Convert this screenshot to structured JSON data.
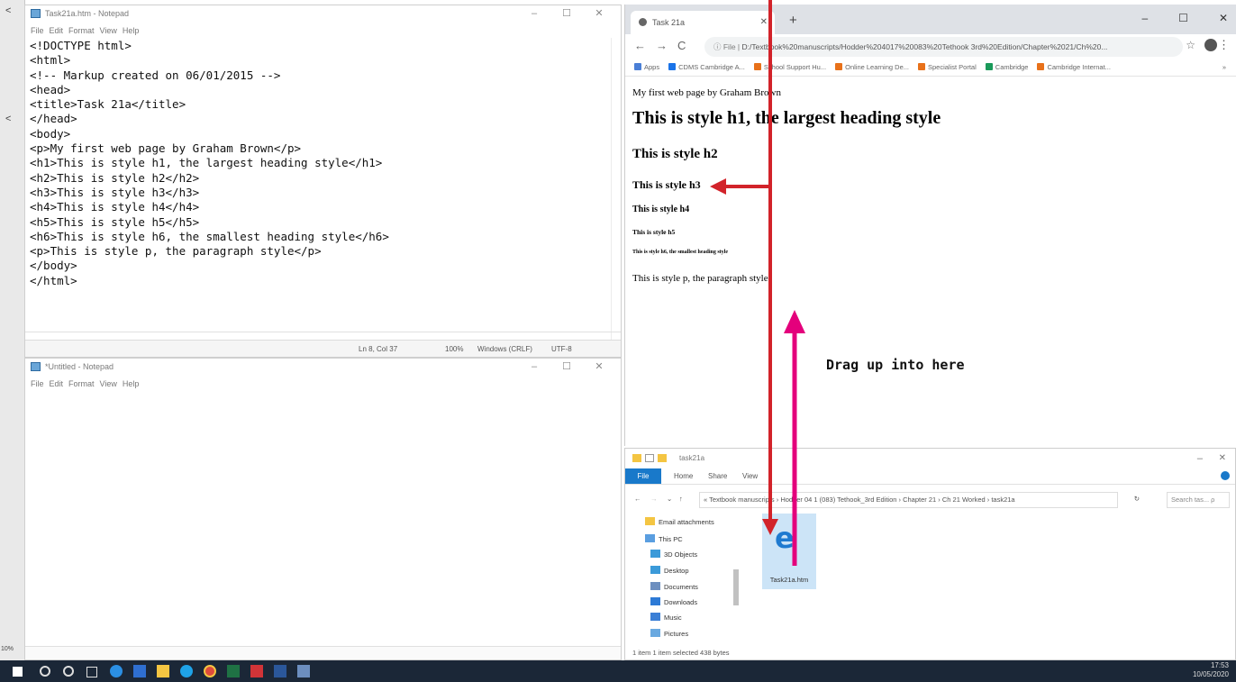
{
  "left_strip": {
    "glyphs": [
      "<",
      "<"
    ],
    "zoom_fragment": "10%"
  },
  "notepad1": {
    "title": "Task21a.htm - Notepad",
    "menu": [
      "File",
      "Edit",
      "Format",
      "View",
      "Help"
    ],
    "controls": [
      "–",
      "☐",
      "✕"
    ],
    "code": "<!DOCTYPE html>\n<html>\n<!-- Markup created on 06/01/2015 -->\n<head>\n<title>Task 21a</title>\n</head>\n<body>\n<p>My first web page by Graham Brown</p>\n<h1>This is style h1, the largest heading style</h1>\n<h2>This is style h2</h2>\n<h3>This is style h3</h3>\n<h4>This is style h4</h4>\n<h5>This is style h5</h5>\n<h6>This is style h6, the smallest heading style</h6>\n<p>This is style p, the paragraph style</p>\n</body>\n</html>",
    "status": {
      "position": "Ln 8, Col 37",
      "zoom": "100%",
      "line_endings": "Windows (CRLF)",
      "encoding": "UTF-8"
    }
  },
  "notepad2": {
    "title": "*Untitled - Notepad",
    "menu": [
      "File",
      "Edit",
      "Format",
      "View",
      "Help"
    ],
    "controls": [
      "–",
      "☐",
      "✕"
    ]
  },
  "chrome": {
    "tab_title": "Task 21a",
    "tab_close": "✕",
    "new_tab": "+",
    "controls": [
      "–",
      "☐",
      "✕"
    ],
    "nav": {
      "back": "←",
      "forward": "→",
      "reload": "C"
    },
    "url_prefix": "ⓘ File |",
    "url": "D:/Textbook%20manuscripts/Hodder%204017%20083%20Tethook 3rd%20Edition/Chapter%2021/Ch%20...",
    "bookmarks": [
      {
        "label": "Apps",
        "color": "#4a7fd6"
      },
      {
        "label": "CDMS Cambridge A...",
        "color": "#1a73e8"
      },
      {
        "label": "School Support Hu...",
        "color": "#e8711a"
      },
      {
        "label": "Online Learning De...",
        "color": "#e8711a"
      },
      {
        "label": "Specialist Portal",
        "color": "#e8711a"
      },
      {
        "label": "Cambridge",
        "color": "#1a9a5a"
      },
      {
        "label": "Cambridge Internat...",
        "color": "#e8711a"
      }
    ],
    "bookmarks_more": "»",
    "page": {
      "p1": "My first web page by Graham Brown",
      "h1": "This is style h1, the largest heading style",
      "h2": "This is style h2",
      "h3": "This is style h3",
      "h4": "This is style h4",
      "h5": "This is style h5",
      "h6": "This is style h6, the smallest heading style",
      "p2": "This is style p, the paragraph style"
    }
  },
  "explorer": {
    "title": "task21a",
    "ribbon": [
      "File",
      "Home",
      "Share",
      "View"
    ],
    "breadcrumb": "« Textbook manuscripts › Hodder 04 1 (083) Tethook_3rd Edition › Chapter 21 › Ch 21 Worked › task21a",
    "search_placeholder": "Search tas... ρ",
    "nav_items": [
      "Email attachments",
      "This PC",
      "3D Objects",
      "Desktop",
      "Documents",
      "Downloads",
      "Music",
      "Pictures"
    ],
    "file_name": "Task21a.htm",
    "status": "1 item    1 item selected  438 bytes"
  },
  "annotation": {
    "text": "Drag up into here",
    "arrow_down_color": "#d2232a",
    "arrow_up_color": "#e4007c"
  },
  "taskbar": {
    "time": "17:53",
    "date": "10/05/2020"
  }
}
